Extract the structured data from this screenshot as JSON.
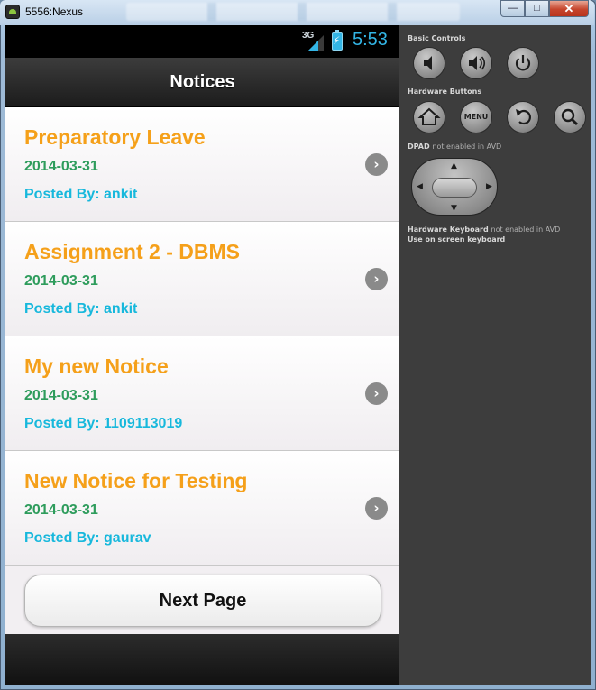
{
  "window": {
    "title": "5556:Nexus",
    "minimize_glyph": "—",
    "maximize_glyph": "□",
    "close_glyph": "✕"
  },
  "statusbar": {
    "network": "3G",
    "time": "5:53"
  },
  "app": {
    "title": "Notices",
    "notices": [
      {
        "title": "Preparatory Leave",
        "date": "2014-03-31",
        "posted_by": "Posted By: ankit"
      },
      {
        "title": "Assignment 2 - DBMS",
        "date": "2014-03-31",
        "posted_by": "Posted By: ankit"
      },
      {
        "title": "My new Notice",
        "date": "2014-03-31",
        "posted_by": "Posted By: 1109113019"
      },
      {
        "title": "New Notice for Testing",
        "date": "2014-03-31",
        "posted_by": "Posted By: gaurav"
      }
    ],
    "chevron_glyph": "›",
    "next_page_label": "Next Page"
  },
  "controls": {
    "basic_controls_label": "Basic Controls",
    "hardware_buttons_label": "Hardware Buttons",
    "menu_label": "MENU",
    "dpad_label": "DPAD",
    "dpad_note": "not enabled in AVD",
    "keyboard_label": "Hardware Keyboard",
    "keyboard_note": "not enabled in AVD",
    "keyboard_hint": "Use on screen keyboard"
  },
  "colors": {
    "notice_title": "#f5a01a",
    "notice_date": "#2e9c5c",
    "notice_poster": "#17b8dc",
    "clock": "#33b5e5"
  },
  "icons": {
    "volume_down": "volume-down-icon",
    "volume_up": "volume-up-icon",
    "power": "power-icon",
    "home": "home-icon",
    "back": "back-icon",
    "search": "search-icon"
  }
}
